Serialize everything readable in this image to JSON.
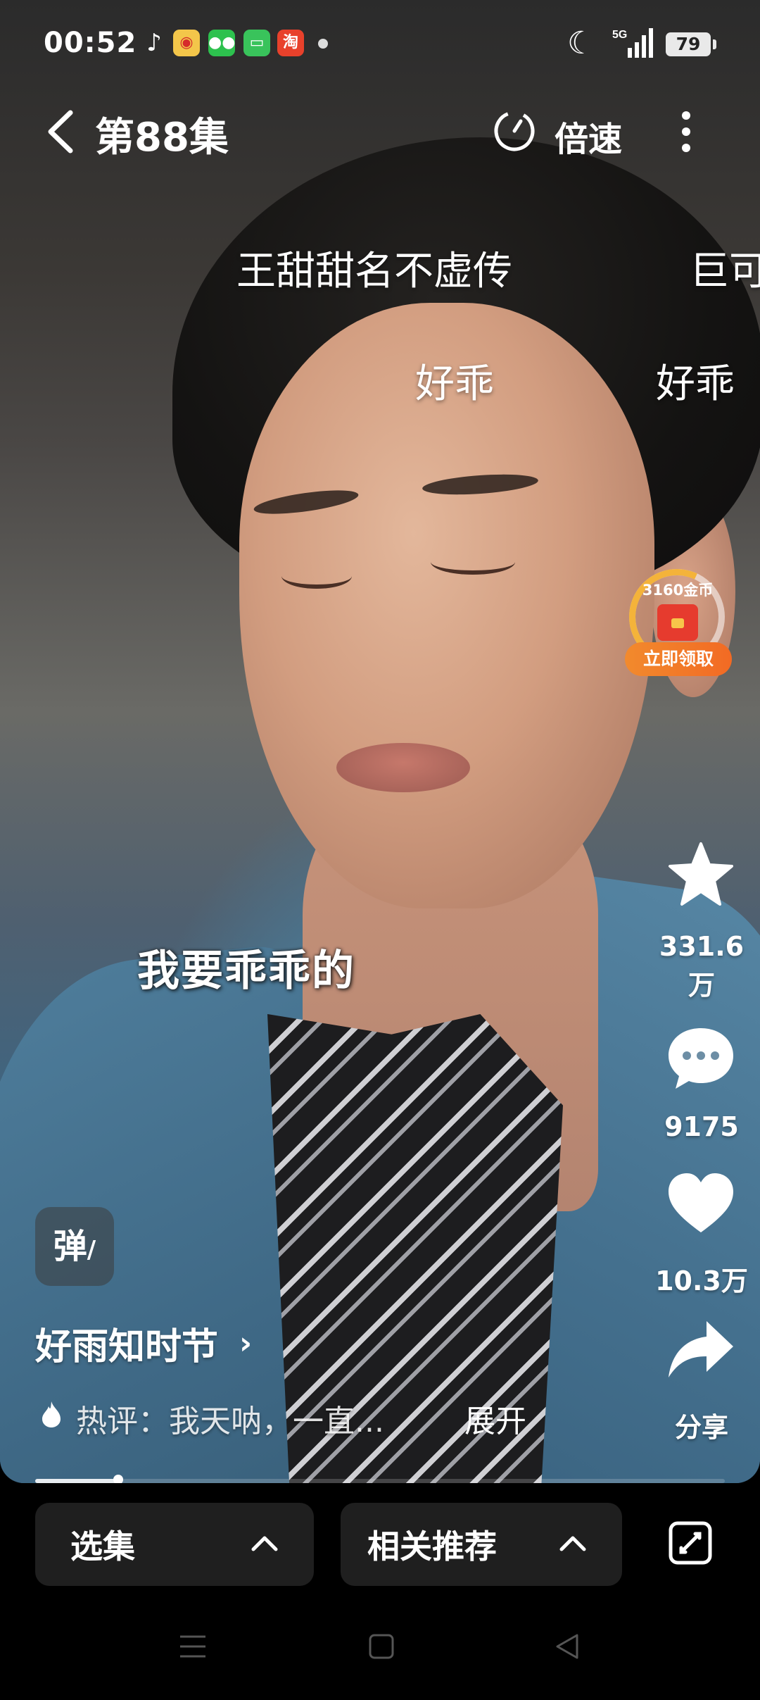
{
  "status_bar": {
    "time": "00:52",
    "app_icons": [
      "tiktok-icon",
      "weibo-icon",
      "wechat-icon",
      "messages-icon",
      "taobao-icon"
    ],
    "network": "5G",
    "battery": "79"
  },
  "header": {
    "episode_title": "第88集",
    "speed_label": "倍速"
  },
  "danmaku": [
    "王甜甜名不虚传",
    "巨可",
    "好乖",
    "好乖"
  ],
  "reward": {
    "coins_text": "3160金币",
    "claim_label": "立即领取"
  },
  "subtitle": "我要乖乖的",
  "actions": {
    "favorite_count_line1": "331.6",
    "favorite_count_line2": "万",
    "comment_count": "9175",
    "like_count": "10.3万",
    "share_label": "分享"
  },
  "danmaku_toggle_label": "弹",
  "show": {
    "name": "好雨知时节",
    "hot_comment": "热评：我天呐，一直...",
    "expand_label": "展开"
  },
  "playback": {
    "progress_fraction": 0.12
  },
  "bottom_bar": {
    "episodes_label": "选集",
    "related_label": "相关推荐"
  },
  "colors": {
    "accent_orange": "#f26a24",
    "pill_bg": "#1f1f1f",
    "coin_gold": "#f4b33a"
  }
}
